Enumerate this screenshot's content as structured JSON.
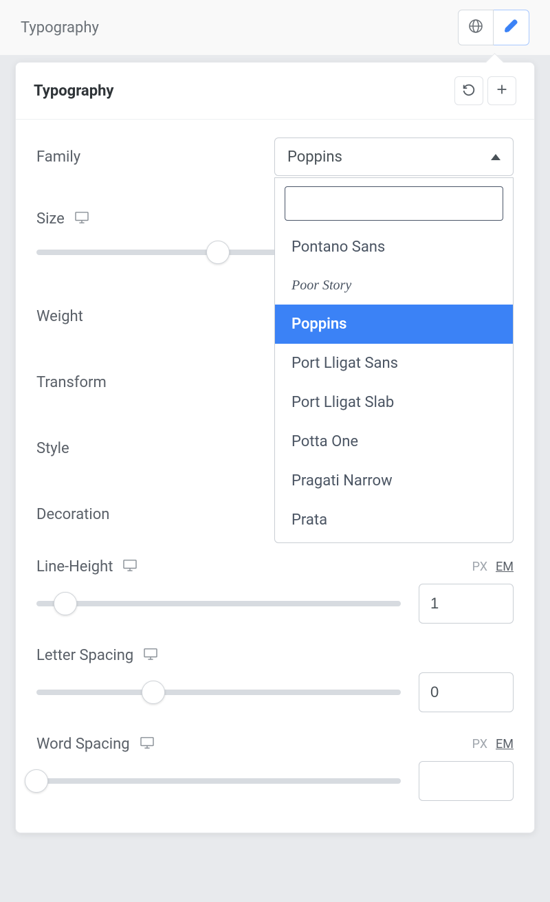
{
  "topbar": {
    "title": "Typography"
  },
  "panel": {
    "title": "Typography",
    "fields": {
      "family": {
        "label": "Family",
        "selected": "Poppins",
        "options": [
          "Pontano Sans",
          "Poor Story",
          "Poppins",
          "Port Lligat Sans",
          "Port Lligat Slab",
          "Potta One",
          "Pragati Narrow",
          "Prata"
        ],
        "search_value": ""
      },
      "size": {
        "label": "Size"
      },
      "weight": {
        "label": "Weight"
      },
      "transform": {
        "label": "Transform"
      },
      "style": {
        "label": "Style"
      },
      "decoration": {
        "label": "Decoration"
      },
      "line_height": {
        "label": "Line-Height",
        "units": {
          "px": "PX",
          "em": "EM",
          "active": "em"
        },
        "value": "1"
      },
      "letter_spacing": {
        "label": "Letter Spacing",
        "value": "0"
      },
      "word_spacing": {
        "label": "Word Spacing",
        "units": {
          "px": "PX",
          "em": "EM",
          "active": "em"
        },
        "value": ""
      }
    }
  }
}
